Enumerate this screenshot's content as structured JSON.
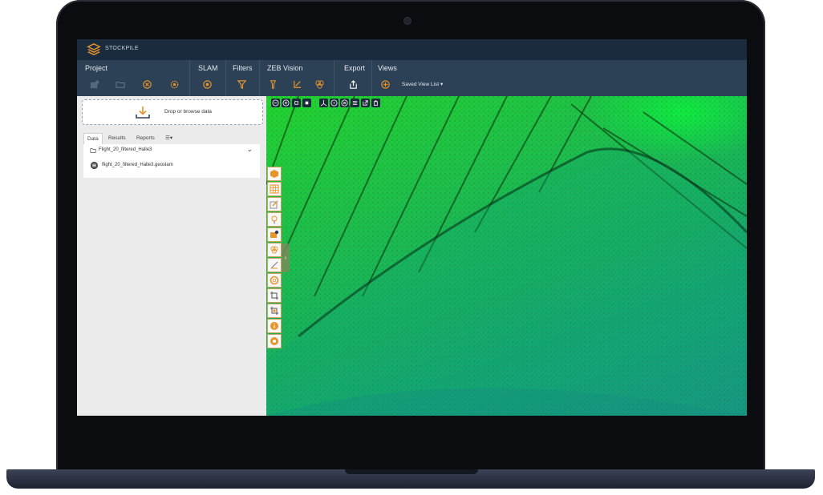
{
  "app": {
    "brand": "STOCKPILE"
  },
  "toolbar": {
    "groups": {
      "project": "Project",
      "slam": "SLAM",
      "filters": "Filters",
      "zeb_vision": "ZEB Vision",
      "export": "Export",
      "views": "Views"
    },
    "saved_view_list": "Saved View List"
  },
  "panel": {
    "drop_text": "Drop or browse data",
    "tabs": [
      "Data",
      "Results",
      "Reports"
    ],
    "folder_name": "Flight_20_filtered_Halle3",
    "file_name": "flight_20_filtered_Halle3.geoslam"
  },
  "colors": {
    "titlebar": "#1a2b3d",
    "toolbar": "#2d4156",
    "accent": "#e8942a",
    "pointcloud_green": "#23d430",
    "pointcloud_teal": "#1a8f8c"
  },
  "icons": {
    "logo": "stockpile-logo-icon",
    "drop": "download-tray-icon"
  }
}
